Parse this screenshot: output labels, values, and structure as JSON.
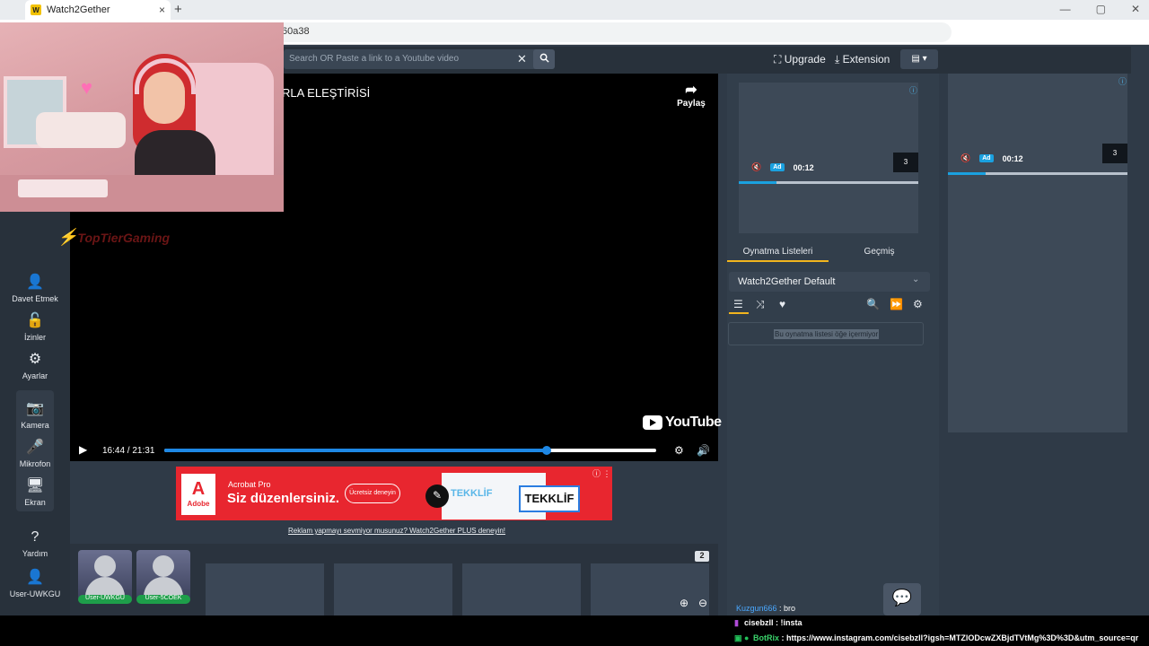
{
  "browser": {
    "tab_title": "Watch2Gether",
    "tab_logo": "W",
    "close_glyph": "×",
    "new_tab_glyph": "+",
    "url_visible": "60a38",
    "window_controls": [
      "—",
      "▢",
      "✕"
    ]
  },
  "header": {
    "search_placeholder": "Search OR Paste a link to a Youtube video",
    "clear_glyph": "✕",
    "upgrade_label": "Upgrade",
    "extension_label": "Extension",
    "lang_glyph": "▤ ▾"
  },
  "sidebar": {
    "items": [
      {
        "label": "Davet Etmek",
        "icon": "add-user-icon",
        "glyph": "👤"
      },
      {
        "label": "İzinler",
        "icon": "unlock-icon",
        "glyph": "🔓"
      },
      {
        "label": "Ayarlar",
        "icon": "gear-icon",
        "glyph": "⚙"
      },
      {
        "label": "Kamera",
        "icon": "camera-icon",
        "glyph": "📷"
      },
      {
        "label": "Mikrofon",
        "icon": "microphone-icon",
        "glyph": "🎤"
      },
      {
        "label": "Ekran",
        "icon": "monitor-icon",
        "glyph": "🖥"
      },
      {
        "label": "Yardım",
        "icon": "help-icon",
        "glyph": "?"
      },
      {
        "label": "User-UWKGU",
        "icon": "user-icon",
        "glyph": "👤"
      }
    ]
  },
  "player": {
    "title": "RLA ELEŞTİRİSİ",
    "share_label": "Paylaş",
    "share_glyph": "➦",
    "provider": "YouTube",
    "play_glyph": "▶",
    "time": "16:44 / 21:31",
    "progress_fraction": 0.7777,
    "settings_glyph": "⚙",
    "volume_glyph": "🔊"
  },
  "ad": {
    "brand_logo": "A",
    "brand_name": "Adobe",
    "product": "Acrobat Pro",
    "headline": "Siz düzenlersiniz.",
    "cta": "Ücretsiz deneyin",
    "doc_label": "TEKKLİF",
    "chip_label": "TEKKLİF",
    "pen_glyph": "✎",
    "info_glyph": "ⓘ ⋮",
    "notice": "Reklam yapmayı sevmiyor musunuz? Watch2Gether PLUS deneyin!"
  },
  "participants": {
    "users": [
      "User-UWKGU",
      "User-5COEK"
    ],
    "count": "2",
    "zoom_in_glyph": "⊕",
    "zoom_out_glyph": "⊖"
  },
  "right_panel": {
    "tile_time": "00:12",
    "tile_ad_badge": "Ad",
    "tile_count": "3",
    "tile_mute_glyph": "🔇",
    "tile_info_glyph": "ⓘ",
    "tile1_progress_fraction": 0.21,
    "tile2_progress_fraction": 0.21,
    "tabs": [
      "Oynatma Listeleri",
      "Geçmiş"
    ],
    "playlist_name": "Watch2Gether Default",
    "playlist_chevron": "⌄",
    "tool_glyphs": [
      "☰",
      "⤨",
      "♥",
      "🔍",
      "⏩",
      "⚙"
    ],
    "empty_text": "Bu oynatma listesi öğe içermiyor"
  },
  "chat": {
    "fab_glyph": "💬",
    "messages": [
      {
        "user": "Kuzgun666",
        "text": " : bro"
      },
      {
        "user": "cisebzll",
        "text": " : !insta"
      },
      {
        "user": "BotRix",
        "text": " : https://www.instagram.com/cisebzll?igsh=MTZlODcwZXBjdTVtMg%3D%3D&utm_source=qr"
      }
    ]
  },
  "sponsor": {
    "text": "TopTierGaming"
  },
  "colors": {
    "accent": "#f2b51e",
    "progress": "#1e88e5",
    "bg_panel": "#2f3a47",
    "ad_red": "#e8262f"
  }
}
